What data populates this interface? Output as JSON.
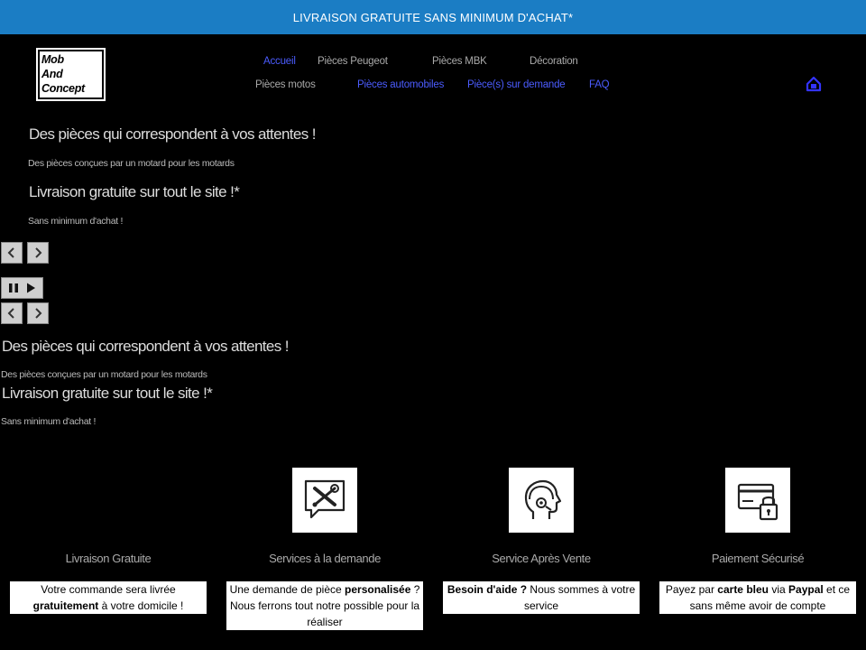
{
  "promo": {
    "text": "LIVRAISON GRATUITE SANS MINIMUM D'ACHAT*"
  },
  "logo": {
    "line1": "Mob",
    "line2": "And",
    "line3": "Concept"
  },
  "nav": {
    "row1": [
      "Accueil",
      "Pièces Peugeot",
      "Pièces MBK",
      "Décoration"
    ],
    "row2": [
      "Pièces motos",
      "Pièces automobiles",
      "Pièce(s) sur demande",
      "FAQ"
    ]
  },
  "cart": {
    "icon": "house-cart-icon",
    "color": "#3333ff"
  },
  "slides": [
    {
      "title": "Des pièces qui correspondent à vos attentes !",
      "subtitle": "Des pièces conçues par un motard pour les motards"
    },
    {
      "title": "Livraison gratuite sur tout le site !*",
      "subtitle": "Sans minimum d'achat !"
    }
  ],
  "slides_repeat": [
    {
      "title": "Des pièces qui correspondent à vos attentes !",
      "subtitle": "Des pièces conçues par un motard pour les motards"
    },
    {
      "title": "Livraison gratuite sur tout le site !*",
      "subtitle": "Sans minimum d'achat !"
    }
  ],
  "features": [
    {
      "icon": "",
      "title": "Livraison Gratuite",
      "parts": [
        {
          "t": "Votre commande sera livrée "
        },
        {
          "t": "gratuitement",
          "b": true
        },
        {
          "t": " à votre domicile !"
        }
      ]
    },
    {
      "icon": "tools-chat-icon",
      "title": "Services à la demande",
      "parts": [
        {
          "t": "Une demande de pièce "
        },
        {
          "t": "personalisée",
          "b": true
        },
        {
          "t": " ? Nous ferrons tout notre possible pour la réaliser"
        }
      ]
    },
    {
      "icon": "headset-support-icon",
      "title": "Service Après Vente",
      "parts": [
        {
          "t": "Besoin d'aide ?",
          "b": true
        },
        {
          "t": " Nous sommes à votre service"
        }
      ]
    },
    {
      "icon": "card-lock-icon",
      "title": "Paiement Sécurisé",
      "parts": [
        {
          "t": "Payez par "
        },
        {
          "t": "carte bleu",
          "b": true
        },
        {
          "t": " via "
        },
        {
          "t": "Paypal",
          "b": true
        },
        {
          "t": " et ce sans même avoir de compte"
        }
      ]
    }
  ]
}
